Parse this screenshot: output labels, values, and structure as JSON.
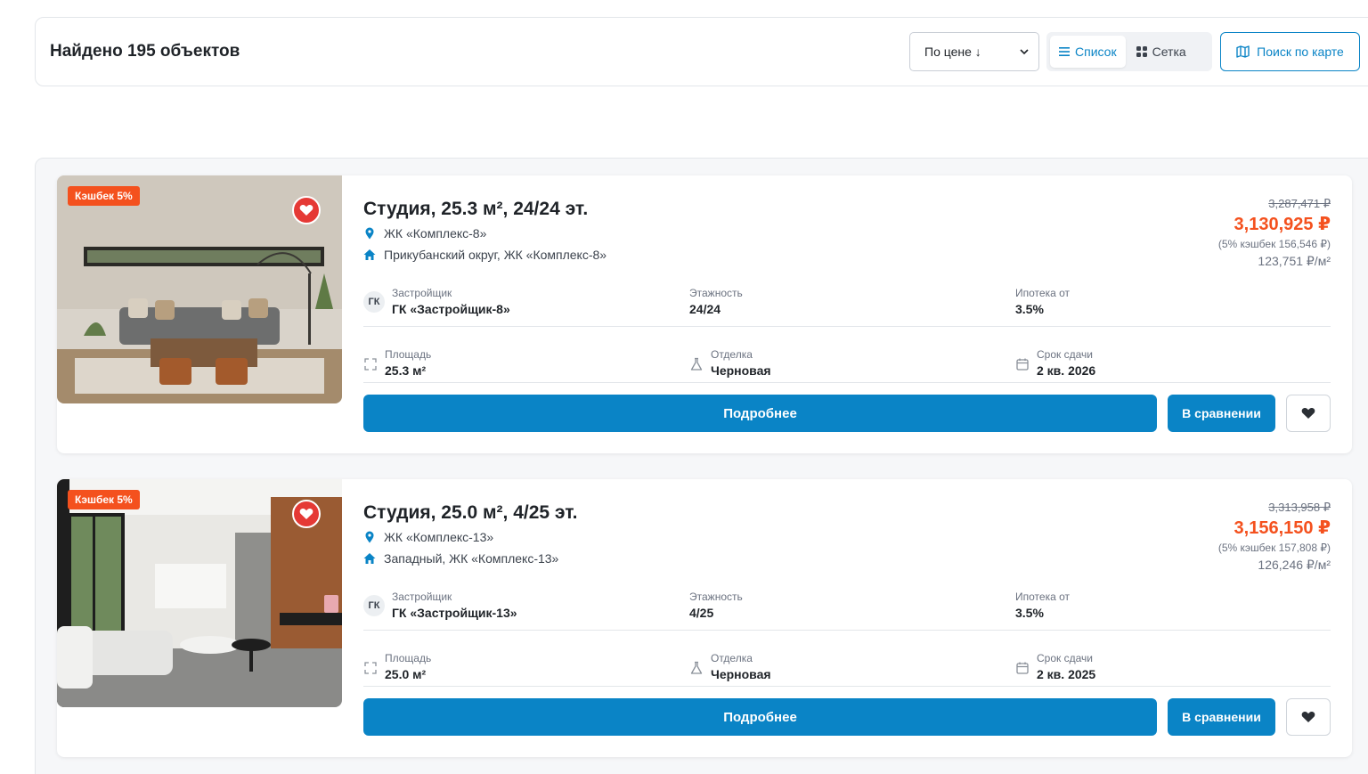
{
  "header": {
    "found_text": "Найдено 195 объектов",
    "sort_value": "По цене ↓",
    "view_list_label": "Список",
    "view_grid_label": "Сетка",
    "map_search_label": "Поиск по карте"
  },
  "colors": {
    "accent": "#0a84c6",
    "price": "#f4511e",
    "cashback_badge": "#f4511e",
    "favorite": "#e53935"
  },
  "listings": [
    {
      "cashback_badge": "Кэшбек 5%",
      "title": "Студия, 25.3 м², 24/24 эт.",
      "complex": "ЖК «Комплекс-8»",
      "address": "Прикубанский округ, ЖК «Комплекс-8»",
      "old_price": "3,287,471 ₽",
      "price": "3,130,925 ₽",
      "cashback_note": "(5% кэшбек 156,546 ₽)",
      "price_per_m2": "123,751 ₽/м²",
      "developer_badge": "ГК",
      "developer_label": "Застройщик",
      "developer": "ГК «Застройщик-8»",
      "floor_label": "Этажность",
      "floor": "24/24",
      "mortgage_label": "Ипотека от",
      "mortgage": "3.5%",
      "area_label": "Площадь",
      "area": "25.3 м²",
      "finish_label": "Отделка",
      "finish": "Черновая",
      "deadline_label": "Срок сдачи",
      "deadline": "2 кв. 2026",
      "details_label": "Подробнее",
      "compare_label": "В сравнении"
    },
    {
      "cashback_badge": "Кэшбек 5%",
      "title": "Студия, 25.0 м², 4/25 эт.",
      "complex": "ЖК «Комплекс-13»",
      "address": "Западный, ЖК «Комплекс-13»",
      "old_price": "3,313,958 ₽",
      "price": "3,156,150 ₽",
      "cashback_note": "(5% кэшбек 157,808 ₽)",
      "price_per_m2": "126,246 ₽/м²",
      "developer_badge": "ГК",
      "developer_label": "Застройщик",
      "developer": "ГК «Застройщик-13»",
      "floor_label": "Этажность",
      "floor": "4/25",
      "mortgage_label": "Ипотека от",
      "mortgage": "3.5%",
      "area_label": "Площадь",
      "area": "25.0 м²",
      "finish_label": "Отделка",
      "finish": "Черновая",
      "deadline_label": "Срок сдачи",
      "deadline": "2 кв. 2025",
      "details_label": "Подробнее",
      "compare_label": "В сравнении"
    }
  ]
}
